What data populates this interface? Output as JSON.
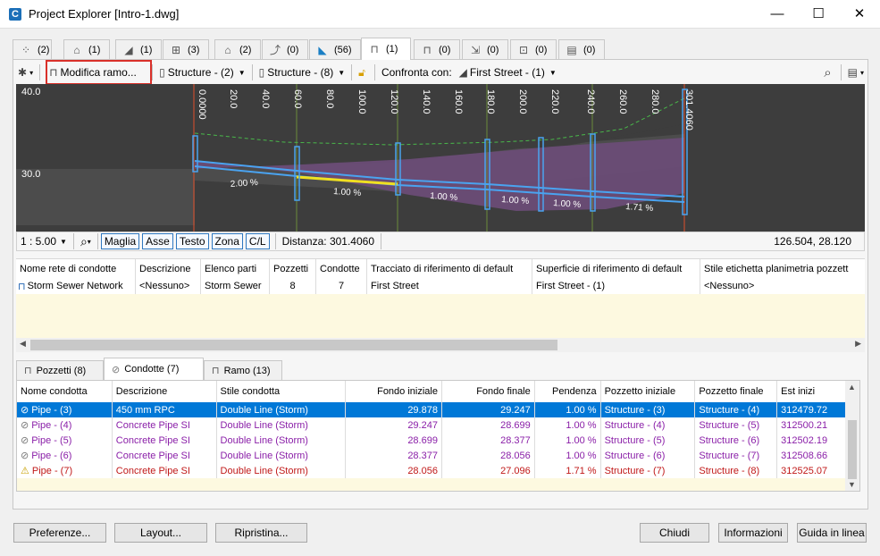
{
  "window": {
    "title": "Project Explorer [Intro-1.dwg]",
    "app_icon": "C",
    "minimize": "—",
    "maximize": "☐",
    "close": "✕"
  },
  "top_tabs": [
    {
      "icon": "point-icon",
      "glyph": "⁘",
      "count": "(2)"
    },
    {
      "icon": "surface-icon",
      "glyph": "⌂",
      "count": "(1)"
    },
    {
      "icon": "alignment-icon",
      "glyph": "◢",
      "count": "(1)"
    },
    {
      "icon": "parcel-icon",
      "glyph": "⊞",
      "count": "(3)"
    },
    {
      "icon": "site-icon",
      "glyph": "⌂",
      "count": "(2)"
    },
    {
      "icon": "feature-line-icon",
      "glyph": "⤴",
      "count": "(0)"
    },
    {
      "icon": "corridor-icon",
      "glyph": "◣",
      "count": "(56)"
    },
    {
      "icon": "pipe-network-icon",
      "glyph": "⊓",
      "count": "(1)"
    },
    {
      "icon": "pressure-network-icon",
      "glyph": "⊓",
      "count": "(0)"
    },
    {
      "icon": "grading-icon",
      "glyph": "⇲",
      "count": "(0)"
    },
    {
      "icon": "view-frame-icon",
      "glyph": "⊡",
      "count": "(0)"
    },
    {
      "icon": "data-shortcut-icon",
      "glyph": "▤",
      "count": "(0)"
    }
  ],
  "toolbar": {
    "modifica": "Modifica ramo...",
    "structure1": "Structure - (2)",
    "structure2": "Structure - (8)",
    "confronta_label": "Confronta con:",
    "confronta_value": "First Street - (1)"
  },
  "profile": {
    "y_labels": [
      "40.0",
      "30.0"
    ],
    "stations": [
      "0.0000",
      "20.0",
      "40.0",
      "60.0",
      "80.0",
      "100.0",
      "120.0",
      "140.0",
      "160.0",
      "180.0",
      "200.0",
      "220.0",
      "240.0",
      "260.0",
      "280.0",
      "301.4060"
    ],
    "slopes": [
      "2.00 %",
      "1.00 %",
      "1.00 %",
      "1.00 %",
      "1.00 %",
      "1.71 %"
    ]
  },
  "profile_bar": {
    "scale": "1 : 5.00",
    "buttons": [
      "Maglia",
      "Asse",
      "Testo",
      "Zona",
      "C/L"
    ],
    "distance": "Distanza: 301.4060",
    "coords": "126.504, 28.120"
  },
  "network_table": {
    "headers": [
      "Nome rete di condotte",
      "Descrizione",
      "Elenco parti",
      "Pozzetti",
      "Condotte",
      "Tracciato di riferimento di default",
      "Superficie di riferimento di default",
      "Stile etichetta planimetria pozzett"
    ],
    "row": [
      "Storm Sewer Network",
      "<Nessuno>",
      "Storm Sewer",
      "8",
      "7",
      "First Street",
      "Street - (1)",
      "<Nessuno>"
    ],
    "row_surface_prefix": "First"
  },
  "bottom_tabs": [
    {
      "label": "Pozzetti (8)",
      "icon": "structure-icon"
    },
    {
      "label": "Condotte (7)",
      "icon": "pipe-icon"
    },
    {
      "label": "Ramo (13)",
      "icon": "branch-icon"
    }
  ],
  "pipes_table": {
    "headers": [
      "Nome condotta",
      "Descrizione",
      "Stile condotta",
      "Fondo iniziale",
      "Fondo finale",
      "Pendenza",
      "Pozzetto iniziale",
      "Pozzetto finale",
      "Est inizi"
    ],
    "rows": [
      [
        "Pipe - (3)",
        "450 mm RPC",
        "Double Line (Storm)",
        "29.878",
        "29.247",
        "1.00 %",
        "Structure - (3)",
        "Structure - (4)",
        "312479.72"
      ],
      [
        "Pipe - (4)",
        "Concrete Pipe SI",
        "Double Line (Storm)",
        "29.247",
        "28.699",
        "1.00 %",
        "Structure - (4)",
        "Structure - (5)",
        "312500.21"
      ],
      [
        "Pipe - (5)",
        "Concrete Pipe SI",
        "Double Line (Storm)",
        "28.699",
        "28.377",
        "1.00 %",
        "Structure - (5)",
        "Structure - (6)",
        "312502.19"
      ],
      [
        "Pipe - (6)",
        "Concrete Pipe SI",
        "Double Line (Storm)",
        "28.377",
        "28.056",
        "1.00 %",
        "Structure - (6)",
        "Structure - (7)",
        "312508.66"
      ],
      [
        "Pipe - (7)",
        "Concrete Pipe SI",
        "Double Line (Storm)",
        "28.056",
        "27.096",
        "1.71 %",
        "Structure - (7)",
        "Structure - (8)",
        "312525.07"
      ]
    ]
  },
  "footer": {
    "preferenze": "Preferenze...",
    "layout": "Layout...",
    "ripristina": "Ripristina...",
    "chiudi": "Chiudi",
    "informazioni": "Informazioni",
    "guida": "Guida in linea"
  }
}
